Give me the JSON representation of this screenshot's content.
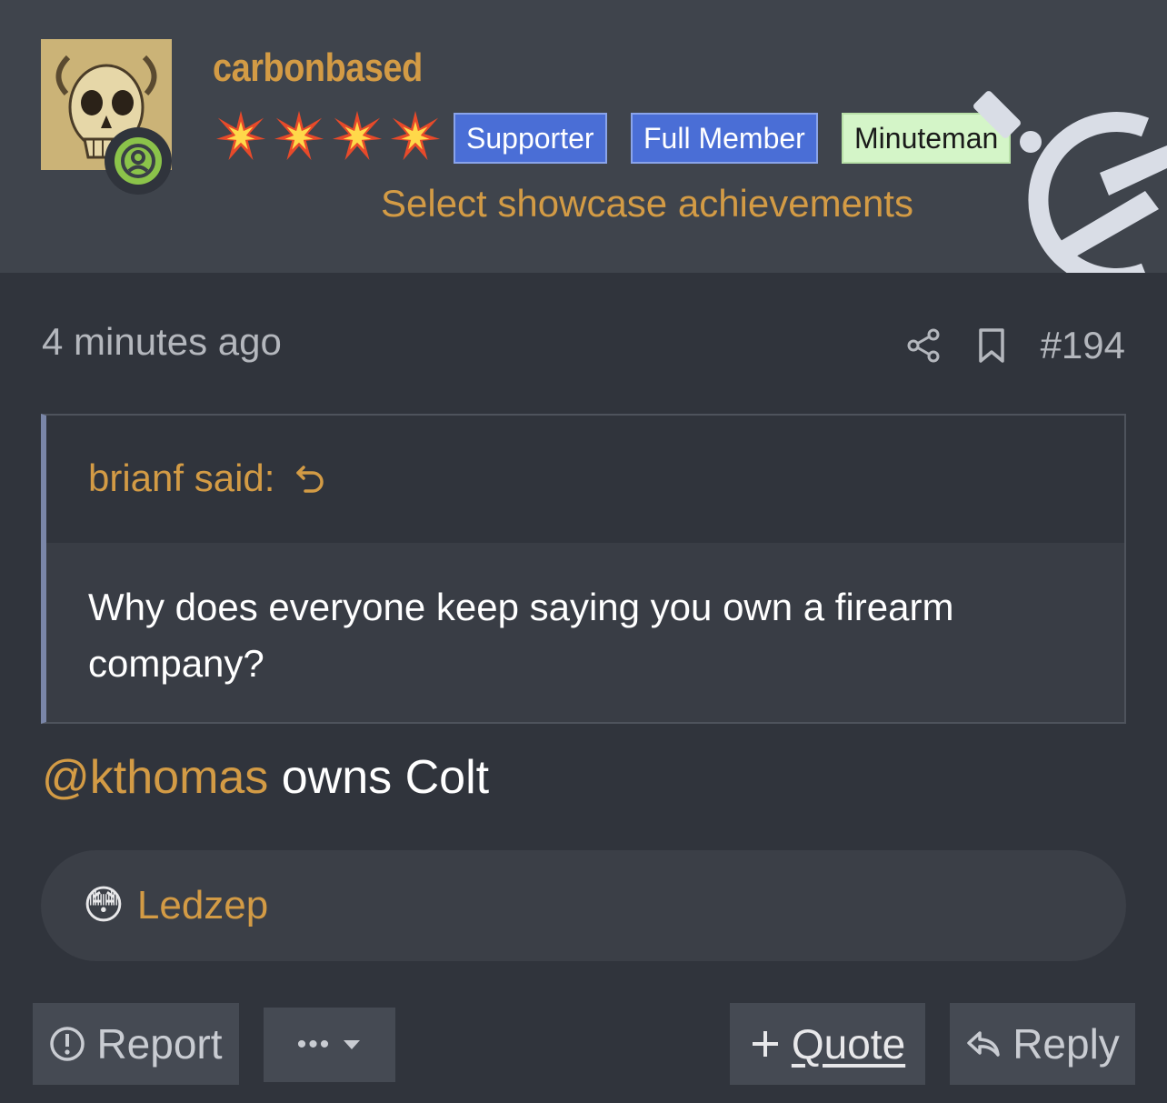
{
  "author": {
    "username": "carbonbased",
    "avatar_icon": "skull-avatar",
    "status_icon": "online-user-icon",
    "stars": [
      "burst-star-icon",
      "burst-star-icon",
      "burst-star-icon",
      "burst-star-icon"
    ],
    "badges": [
      {
        "label": "Supporter",
        "color": "#4a6ed6"
      },
      {
        "label": "Full Member",
        "color": "#4a6ed6"
      },
      {
        "label": "Minuteman",
        "color": "#d4f5c8"
      }
    ],
    "showcase_link": "Select showcase achievements",
    "logo_icon": "site-logo-icon"
  },
  "meta": {
    "time": "4 minutes ago",
    "post_number": "#194",
    "share_icon": "share-icon",
    "bookmark_icon": "bookmark-icon"
  },
  "quote": {
    "header": "brianf said:",
    "body": "Why does everyone keep saying you own a firearm company?"
  },
  "message": {
    "mention": "@kthomas",
    "text": " owns Colt"
  },
  "reactions": {
    "emoji": "😳",
    "names": "Ledzep"
  },
  "actions": {
    "report": "Report",
    "more": "•••",
    "quote": "Quote",
    "reply": "Reply"
  },
  "colors": {
    "accent": "#d39b45",
    "background": "#30343c",
    "header": "#3f444c"
  }
}
